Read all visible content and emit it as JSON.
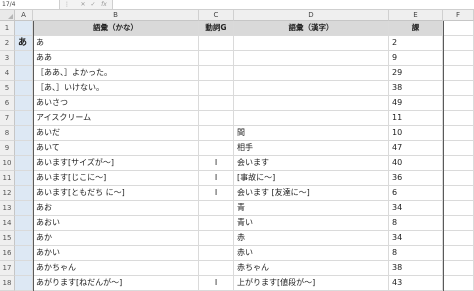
{
  "formula_bar": {
    "name_box": "17/4",
    "fx": "fx"
  },
  "columns": [
    "A",
    "B",
    "C",
    "D",
    "E",
    "F"
  ],
  "header_row": {
    "row_num": "1",
    "b": "語彙（かな）",
    "c": "動詞G",
    "d": "語彙（漢字）",
    "e": "課"
  },
  "group_label": "あ",
  "rows": [
    {
      "n": "2",
      "b": "あ",
      "c": "",
      "d": "",
      "e": "2"
    },
    {
      "n": "3",
      "b": "ああ",
      "c": "",
      "d": "",
      "e": "9"
    },
    {
      "n": "4",
      "b": "［ああ、］よかった。",
      "c": "",
      "d": "",
      "e": "29"
    },
    {
      "n": "5",
      "b": "［あ、］いけない。",
      "c": "",
      "d": "",
      "e": "38"
    },
    {
      "n": "6",
      "b": "あいさつ",
      "c": "",
      "d": "",
      "e": "49"
    },
    {
      "n": "7",
      "b": "アイスクリーム",
      "c": "",
      "d": "",
      "e": "11"
    },
    {
      "n": "8",
      "b": "あいだ",
      "c": "",
      "d": "間",
      "e": "10"
    },
    {
      "n": "9",
      "b": "あいて",
      "c": "",
      "d": "相手",
      "e": "47"
    },
    {
      "n": "10",
      "b": "あいます[サイズが〜]",
      "c": "I",
      "d": "会います",
      "e": "40"
    },
    {
      "n": "11",
      "b": "あいます[じこに〜]",
      "c": "I",
      "d": "[事故に〜]",
      "e": "36"
    },
    {
      "n": "12",
      "b": "あいます[ともだち に〜]",
      "c": "I",
      "d": "会います [友達に〜]",
      "e": "6"
    },
    {
      "n": "13",
      "b": "あお",
      "c": "",
      "d": "青",
      "e": "34"
    },
    {
      "n": "14",
      "b": "あおい",
      "c": "",
      "d": "青い",
      "e": "8"
    },
    {
      "n": "15",
      "b": "あか",
      "c": "",
      "d": "赤",
      "e": "34"
    },
    {
      "n": "16",
      "b": "あかい",
      "c": "",
      "d": "赤い",
      "e": "8"
    },
    {
      "n": "17",
      "b": "あかちゃん",
      "c": "",
      "d": "赤ちゃん",
      "e": "38"
    },
    {
      "n": "18",
      "b": "あがります[ねだんが〜]",
      "c": "I",
      "d": "上がります[値段が〜]",
      "e": "43"
    }
  ]
}
